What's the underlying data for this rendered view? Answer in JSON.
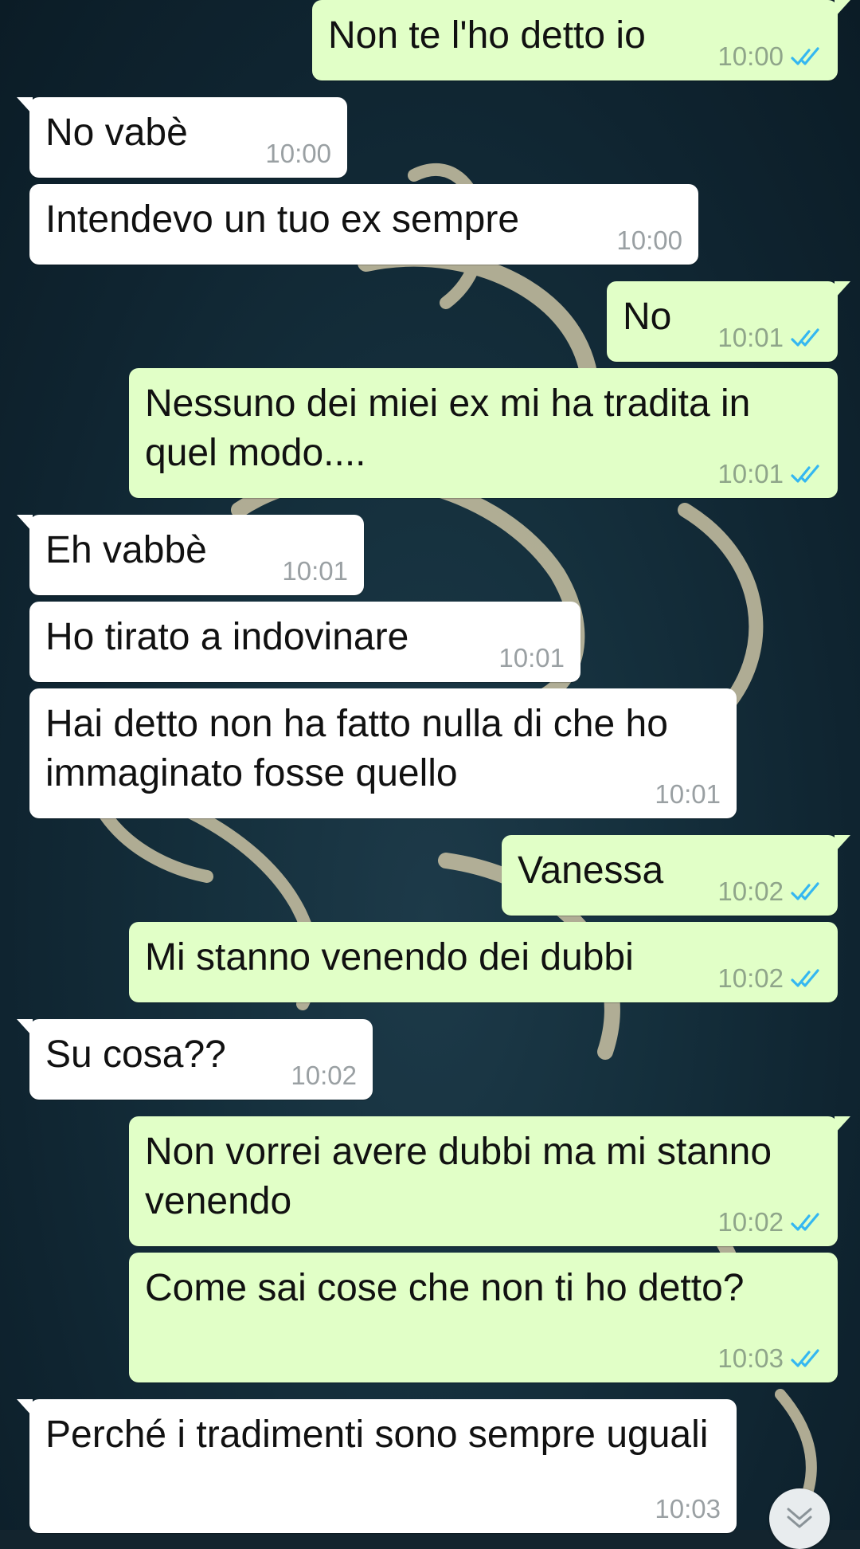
{
  "messages": [
    {
      "direction": "outgoing",
      "text": "Non te l'ho detto io",
      "time": "10:00",
      "status": "read"
    },
    {
      "direction": "incoming",
      "text": "No vabè",
      "time": "10:00"
    },
    {
      "direction": "incoming",
      "text": "Intendevo un tuo ex sempre",
      "time": "10:00"
    },
    {
      "direction": "outgoing",
      "text": "No",
      "time": "10:01",
      "status": "read"
    },
    {
      "direction": "outgoing",
      "text": "Nessuno dei miei ex mi ha tradita in quel modo....",
      "time": "10:01",
      "status": "read"
    },
    {
      "direction": "incoming",
      "text": "Eh vabbè",
      "time": "10:01"
    },
    {
      "direction": "incoming",
      "text": "Ho tirato a indovinare",
      "time": "10:01"
    },
    {
      "direction": "incoming",
      "text": "Hai detto non ha fatto nulla di che ho immaginato fosse quello",
      "time": "10:01"
    },
    {
      "direction": "outgoing",
      "text": "Vanessa",
      "time": "10:02",
      "status": "read"
    },
    {
      "direction": "outgoing",
      "text": "Mi stanno venendo dei dubbi",
      "time": "10:02",
      "status": "read"
    },
    {
      "direction": "incoming",
      "text": "Su cosa??",
      "time": "10:02"
    },
    {
      "direction": "outgoing",
      "text": "Non vorrei avere dubbi ma mi stanno venendo",
      "time": "10:02",
      "status": "read"
    },
    {
      "direction": "outgoing",
      "text": "Come sai cose che non ti ho detto?",
      "time": "10:03",
      "status": "read"
    },
    {
      "direction": "incoming",
      "text": "Perché i tradimenti sono sempre uguali",
      "time": "10:03"
    }
  ],
  "colors": {
    "incoming_bubble": "#ffffff",
    "outgoing_bubble": "#e1ffc7",
    "read_ticks": "#34b7f1",
    "wallpaper": "#13242e"
  },
  "icons": {
    "read_receipt": "double-check-icon",
    "scroll_down": "chevron-down-icon"
  }
}
